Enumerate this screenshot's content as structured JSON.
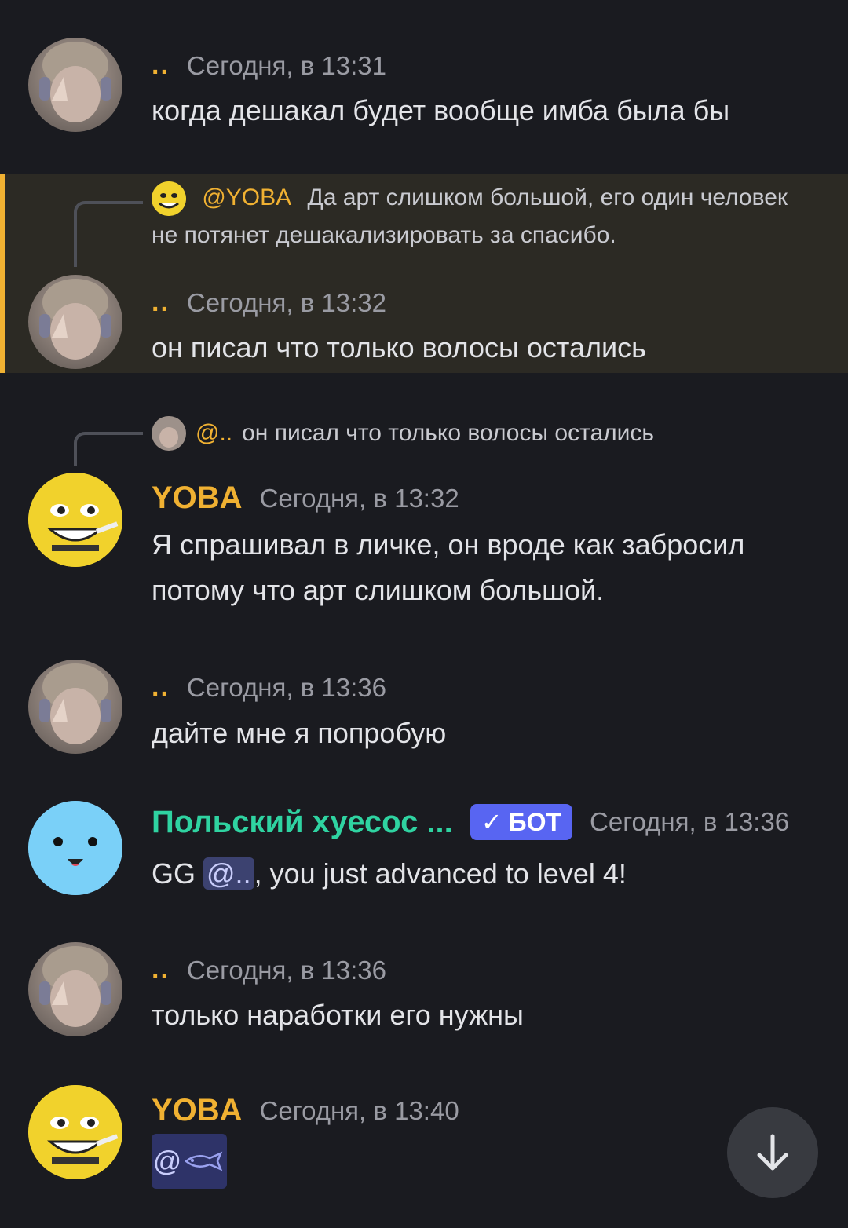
{
  "messages": [
    {
      "author": "..",
      "time": "Сегодня, в 13:31",
      "text": "когда дешакал будет вообще имба была бы"
    },
    {
      "reply": {
        "mention": "@YOBA",
        "text": "Да арт слишком большой, его один человек не потянет дешакализировать за спасибо."
      },
      "author": "..",
      "time": "Сегодня, в 13:32",
      "text": "он писал что только волосы остались"
    },
    {
      "reply": {
        "mention": "@..",
        "text": "он писал что только волосы остались"
      },
      "author": "YOBA",
      "time": "Сегодня, в 13:32",
      "text": "Я спрашивал в личке, он вроде как забросил потому что арт слишком большой."
    },
    {
      "author": "..",
      "time": "Сегодня, в 13:36",
      "text": "дайте мне я попробую"
    },
    {
      "author": "Польский хуесос ...",
      "badge": "БОТ",
      "time": "Сегодня, в 13:36",
      "text_prefix": "GG ",
      "mention": "@..",
      "text_suffix": ", you just advanced to level 4!"
    },
    {
      "author": "..",
      "time": "Сегодня, в 13:36",
      "text": "только наработки его нужны"
    },
    {
      "author": "YOBA",
      "time": "Сегодня, в 13:40",
      "mention": "@"
    }
  ],
  "colors": {
    "accent": "#f0b132",
    "bot_name": "#2fd3a1",
    "badge": "#5865f2",
    "background": "#1a1b20"
  },
  "icons": {
    "badge_check": "check-icon",
    "scroll_down": "arrow-down-icon",
    "mention_fish": "fish-icon"
  }
}
